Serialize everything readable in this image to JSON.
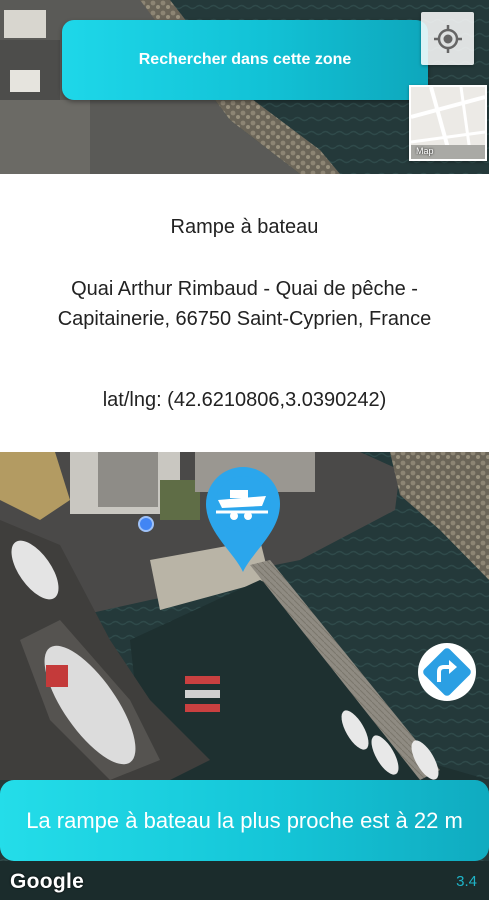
{
  "search_area_button": {
    "label": "Rechercher dans cette zone"
  },
  "locate_button": {
    "icon": "crosshair-icon"
  },
  "map_type_toggle": {
    "label": "Map"
  },
  "place_info": {
    "title": "Rampe à bateau",
    "address": "Quai Arthur Rimbaud - Quai de pêche - Capitainerie, 66750 Saint-Cyprien, France",
    "coordinates": "lat/lng: (42.6210806,3.0390242)"
  },
  "marker": {
    "icon": "boat-trailer-icon",
    "color": "#2ba6ec"
  },
  "route_button": {
    "icon": "turn-right-icon",
    "color": "#2b9fe3"
  },
  "nearest_banner": {
    "text": "La rampe à bateau la plus proche est à 22 m"
  },
  "map_attribution": {
    "logo": "Google"
  },
  "version": "3.4",
  "colors": {
    "accent": "#15c6d8",
    "marker": "#2ba6ec",
    "my_location": "#4285f4"
  }
}
